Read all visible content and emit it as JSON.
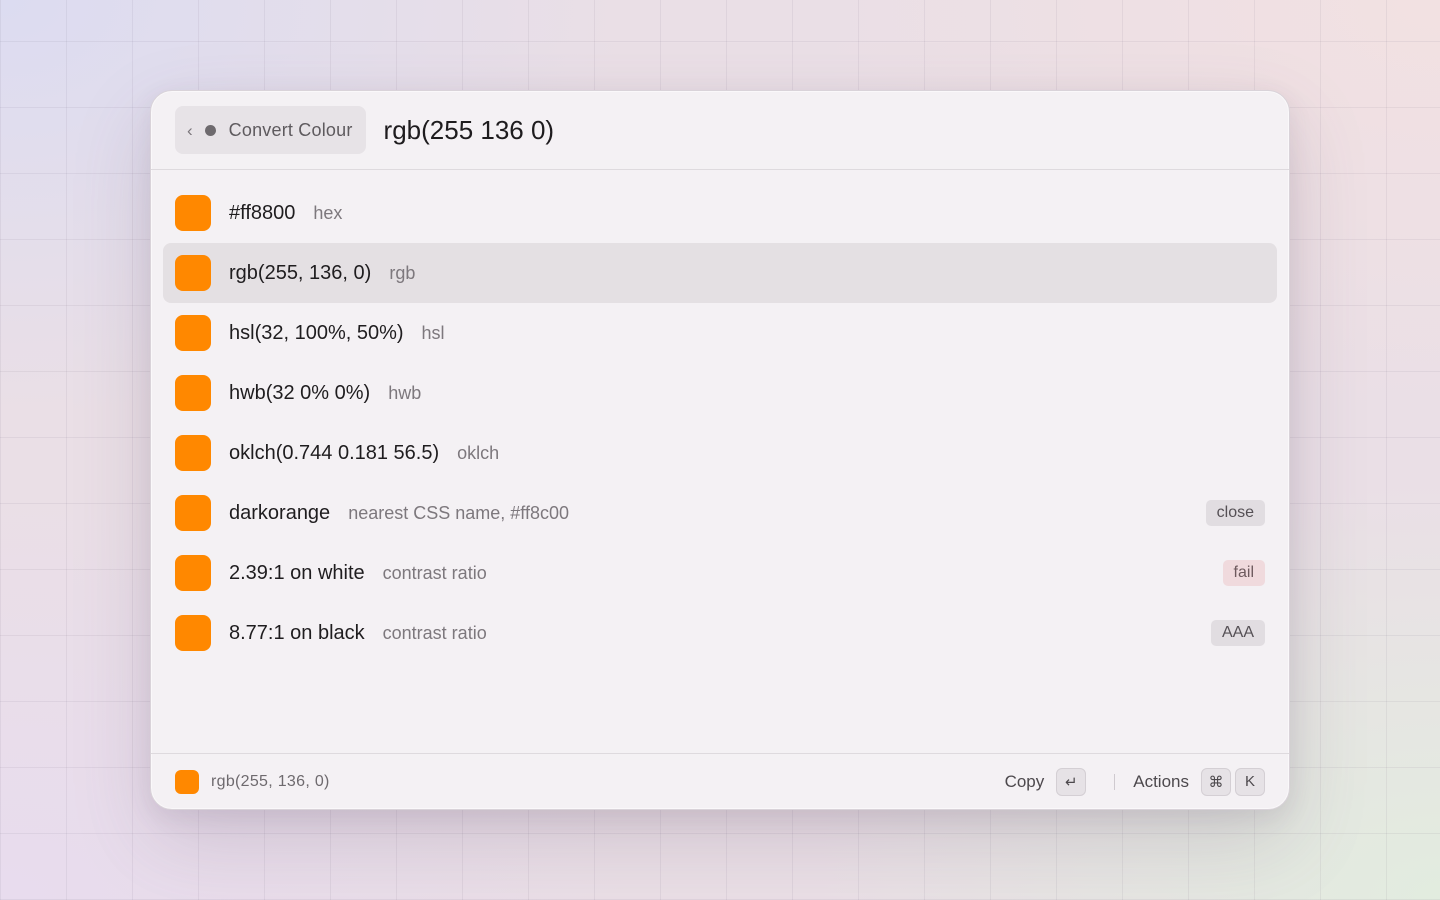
{
  "colors": {
    "swatch": "#ff8800"
  },
  "header": {
    "back_chevron": "‹",
    "back_label": "Convert Colour",
    "query": "rgb(255 136 0)"
  },
  "rows": [
    {
      "value": "#ff8800",
      "sub": "hex",
      "badge": ""
    },
    {
      "value": "rgb(255, 136, 0)",
      "sub": "rgb",
      "badge": "",
      "selected": true
    },
    {
      "value": "hsl(32, 100%, 50%)",
      "sub": "hsl",
      "badge": ""
    },
    {
      "value": "hwb(32 0% 0%)",
      "sub": "hwb",
      "badge": ""
    },
    {
      "value": "oklch(0.744 0.181 56.5)",
      "sub": "oklch",
      "badge": ""
    },
    {
      "value": "darkorange",
      "sub": "nearest CSS name, #ff8c00",
      "badge": "close"
    },
    {
      "value": "2.39:1 on white",
      "sub": "contrast ratio",
      "badge": "fail"
    },
    {
      "value": "8.77:1 on black",
      "sub": "contrast ratio",
      "badge": "AAA"
    }
  ],
  "footer": {
    "selected_value": "rgb(255, 136, 0)",
    "copy_label": "Copy",
    "copy_key": "↵",
    "actions_label": "Actions",
    "actions_key_1": "⌘",
    "actions_key_2": "K"
  }
}
